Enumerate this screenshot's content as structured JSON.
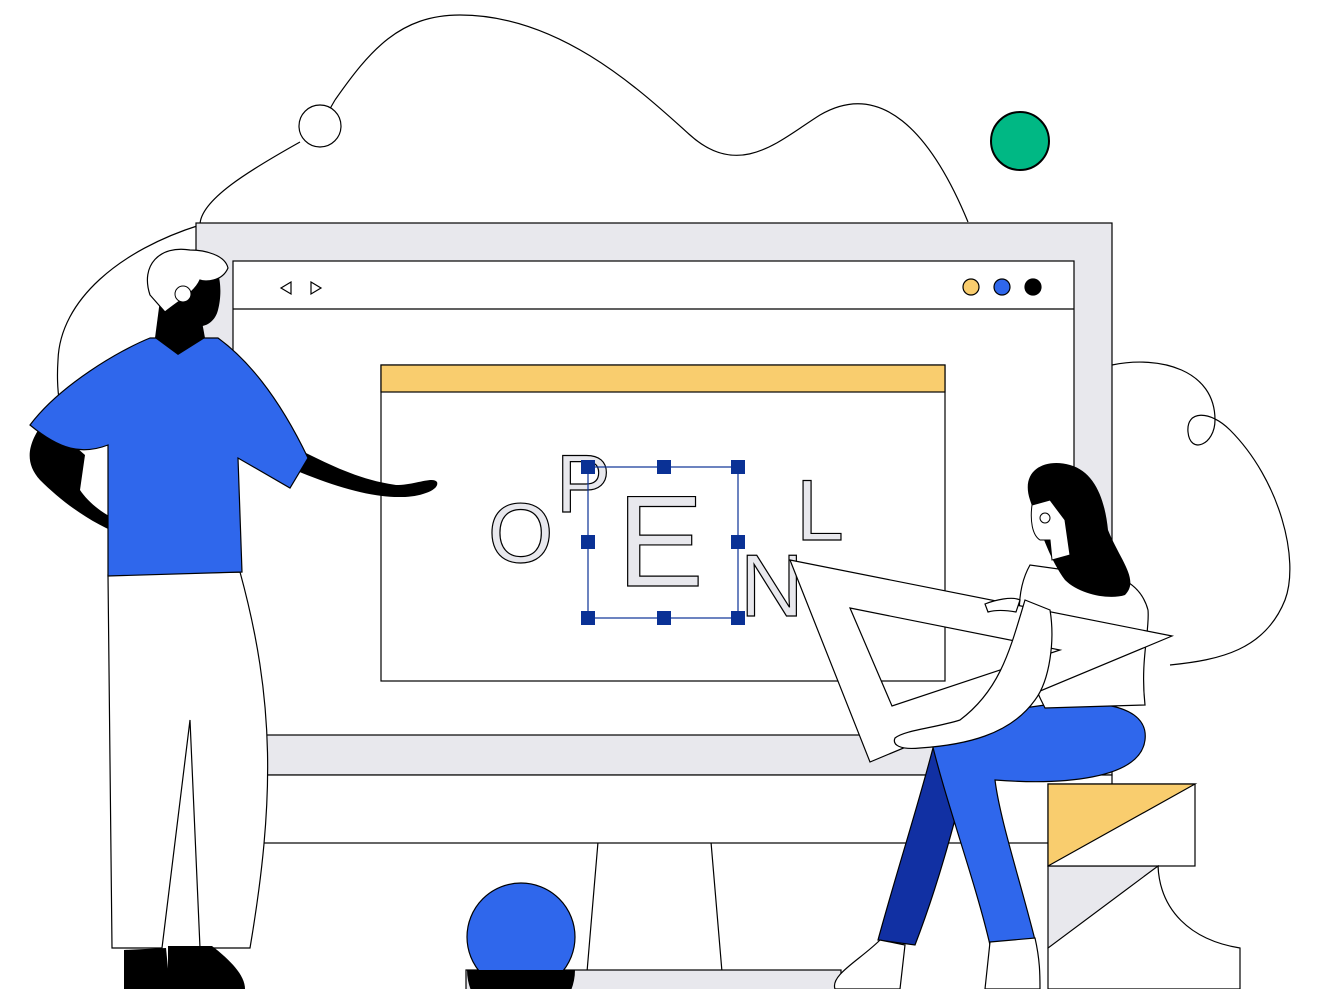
{
  "illustration": {
    "letters": {
      "o": "O",
      "p": "P",
      "e": "E",
      "n": "N",
      "l": "L"
    },
    "nav_icons": {
      "back": "triangle-left-icon",
      "forward": "triangle-right-icon"
    },
    "window_dots": [
      "#f9cd6e",
      "#2f67ec",
      "#000000"
    ],
    "colors": {
      "accent_blue": "#2f67ec",
      "dark_blue": "#1130a3",
      "handle_blue": "#0a3195",
      "yellow": "#f9cd6e",
      "green": "#00b884",
      "monitor_gray": "#e8e8ed",
      "letter_fill": "#e8e8ed",
      "ink": "#000000"
    }
  }
}
